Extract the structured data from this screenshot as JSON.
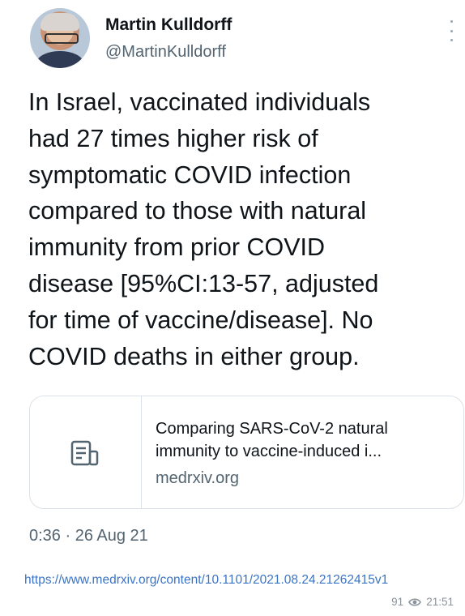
{
  "author": {
    "name": "Martin Kulldorff",
    "handle": "@MartinKulldorff"
  },
  "tweet": {
    "text": "In Israel, vaccinated individuals\nhad 27 times higher risk of\nsymptomatic COVID infection\ncompared to those with natural\nimmunity from prior COVID\ndisease [95%CI:13-57, adjusted\nfor time of vaccine/disease]. No\nCOVID deaths in either group."
  },
  "card": {
    "title_line1": "Comparing SARS-CoV-2 natural",
    "title_line2": "immunity to vaccine-induced i...",
    "domain": "medrxiv.org",
    "icon": "document-icon"
  },
  "timestamp": "0:36 · 26 Aug 21",
  "message": {
    "link": "https://www.medrxiv.org/content/10.1101/2021.08.24.21262415v1",
    "views": "91",
    "time": "21:51",
    "view_icon": "eye-icon"
  },
  "colors": {
    "text": "#0f1419",
    "secondary": "#536471",
    "link": "#3b74c4",
    "border": "#dbe1e6"
  }
}
